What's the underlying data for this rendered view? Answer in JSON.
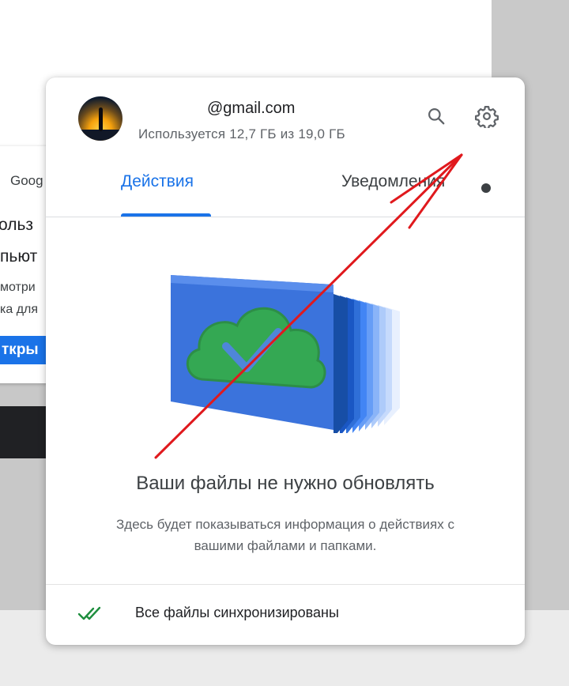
{
  "background": {
    "google_label": "Goog",
    "line1": "ольз",
    "line2": "пьют",
    "line3": "мотри",
    "line4": "ка для",
    "button_label": "ткры"
  },
  "account": {
    "email": "@gmail.com",
    "storage": "Используется 12,7 ГБ из 19,0 ГБ"
  },
  "tabs": [
    {
      "label": "Действия",
      "active": true
    },
    {
      "label": "Уведомления",
      "active": false,
      "has_dot": true
    }
  ],
  "main": {
    "headline": "Ваши файлы не нужно обновлять",
    "description": "Здесь будет показываться информация о действиях с вашими файлами и папками."
  },
  "footer": {
    "status": "Все файлы синхронизированы"
  },
  "icons": {
    "search": "search-icon",
    "settings": "gear-icon",
    "sync_status": "double-check-icon"
  },
  "colors": {
    "accent": "#1a73e8",
    "sync_ok": "#1e8e3e",
    "annotation": "#e0191d"
  }
}
